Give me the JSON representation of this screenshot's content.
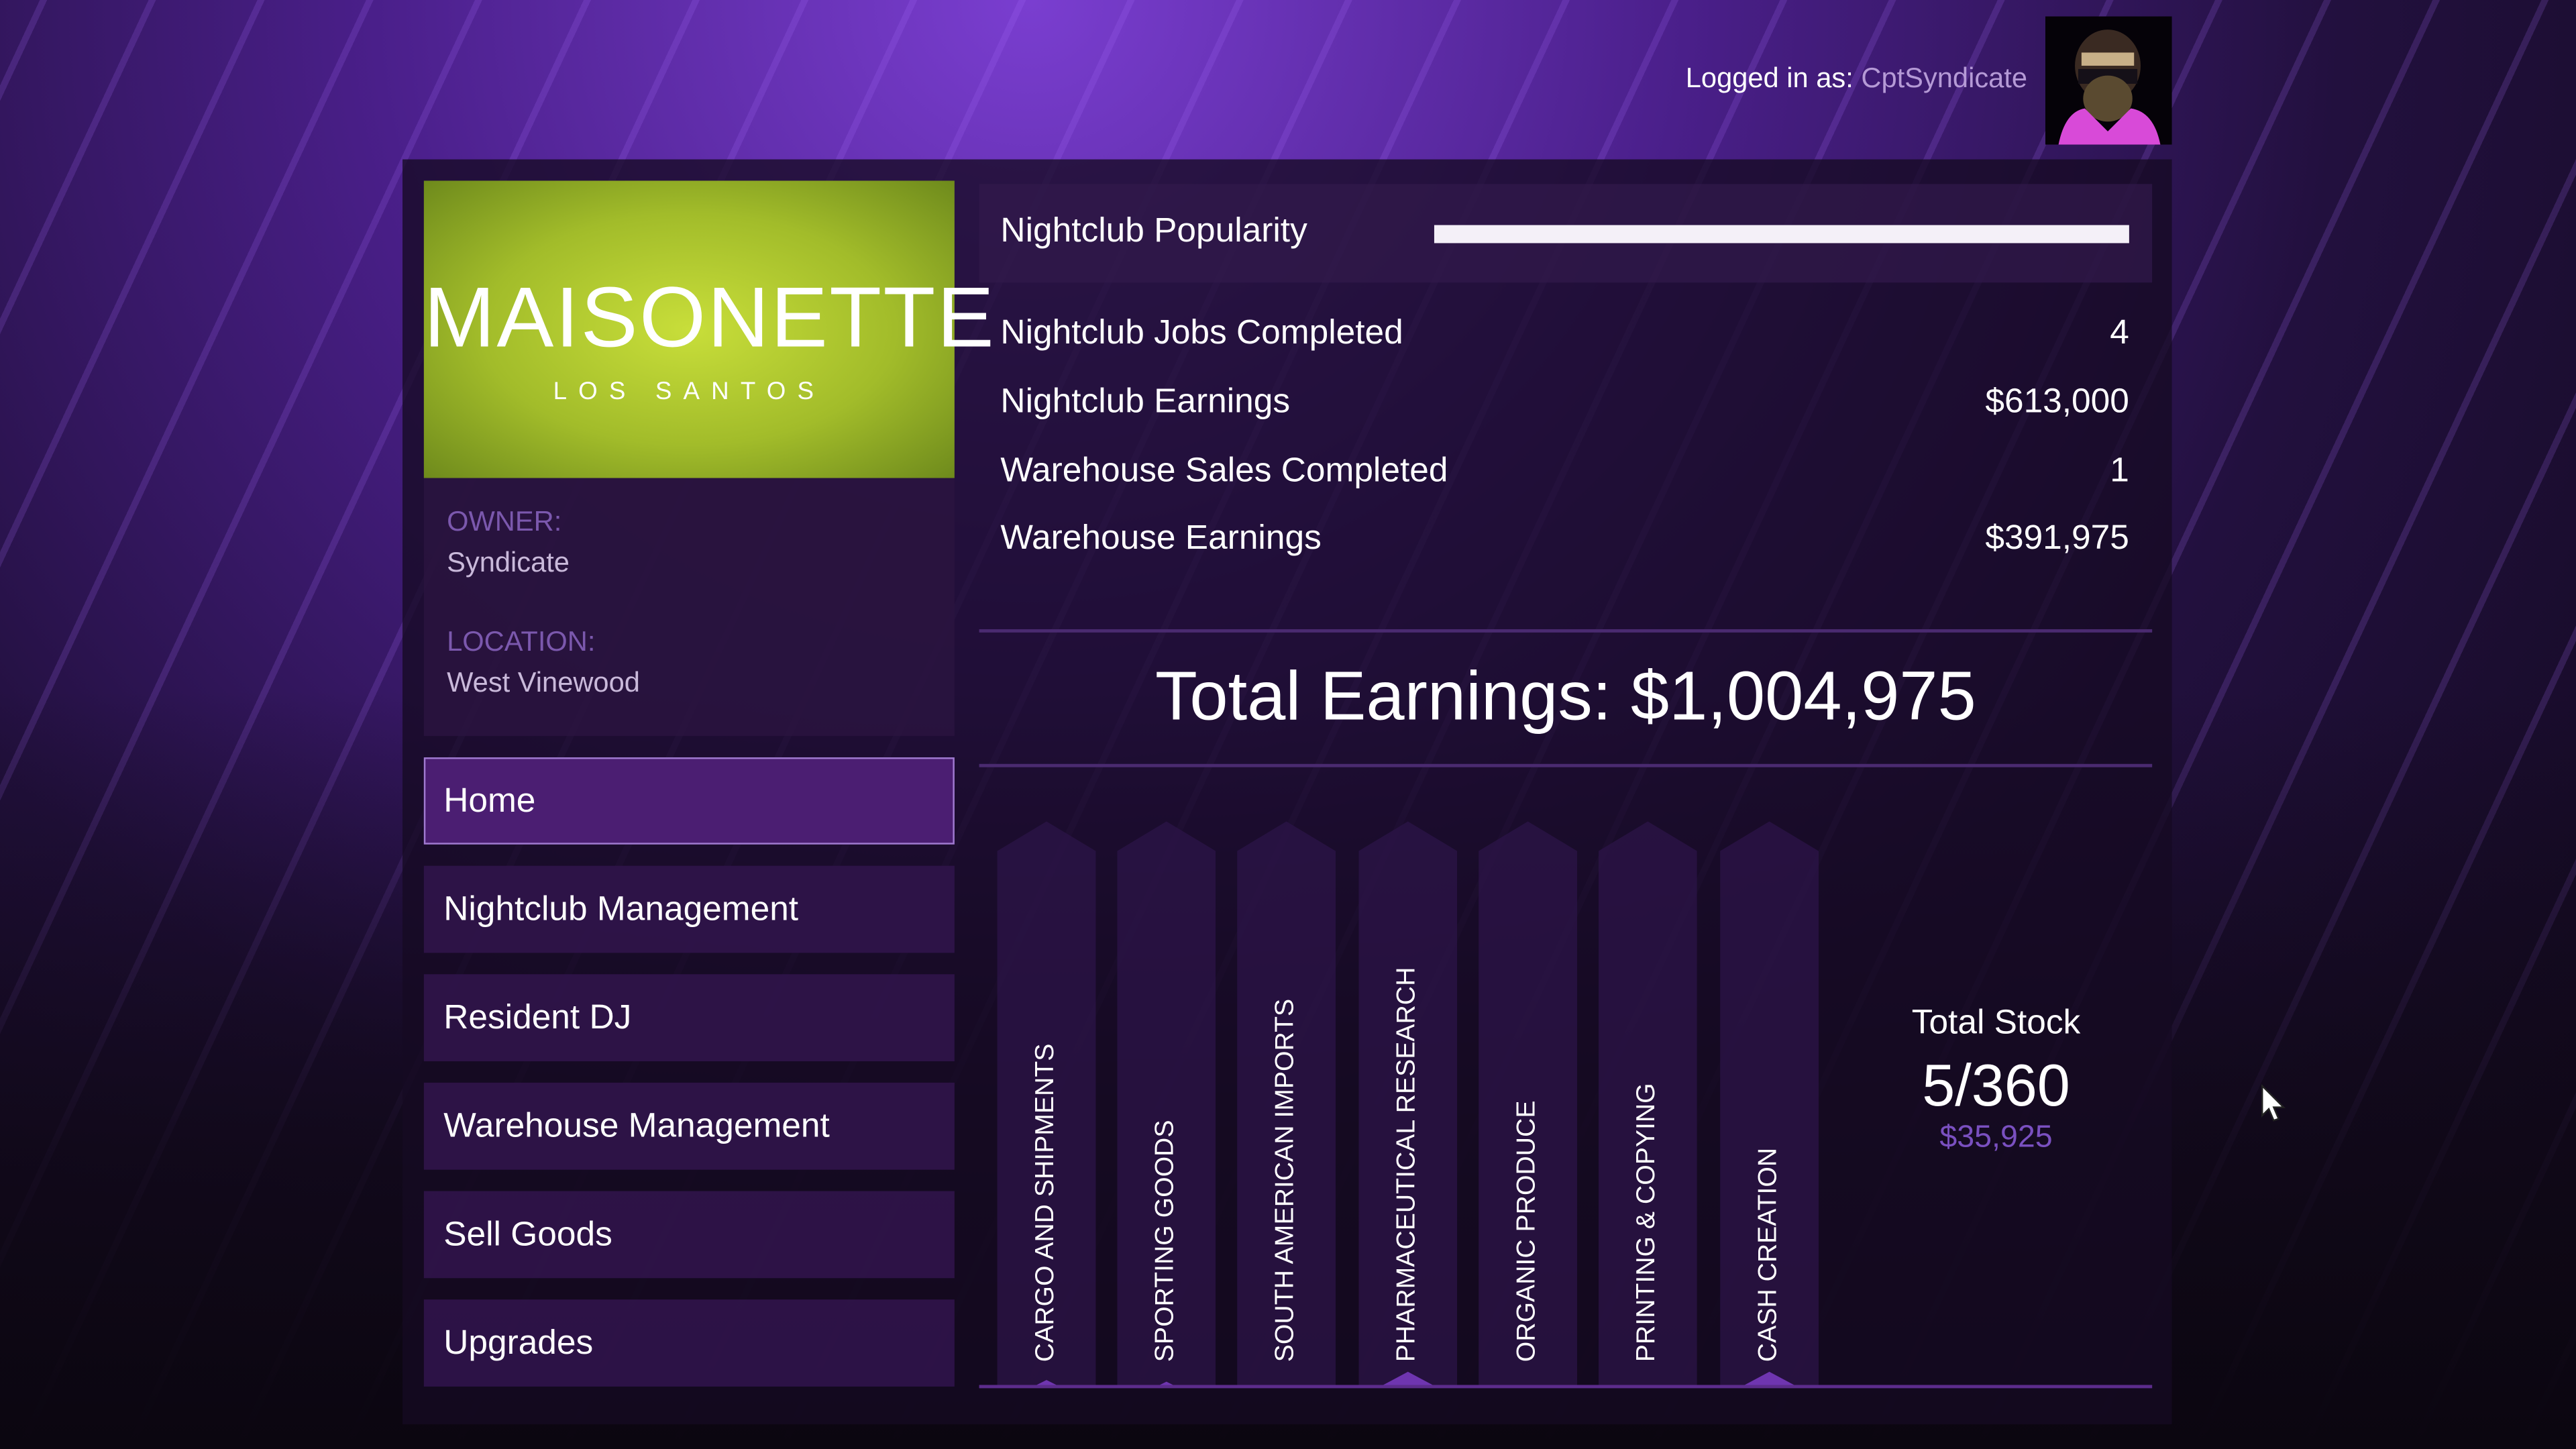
{
  "header": {
    "logged_in_label": "Logged in as:",
    "username": "CptSyndicate"
  },
  "business": {
    "logo_name": "MAISONETTE",
    "logo_sub": "LOS SANTOS",
    "owner_label": "OWNER:",
    "owner": "Syndicate",
    "location_label": "LOCATION:",
    "location": "West Vinewood"
  },
  "nav": [
    {
      "label": "Home",
      "selected": true
    },
    {
      "label": "Nightclub Management"
    },
    {
      "label": "Resident DJ"
    },
    {
      "label": "Warehouse Management"
    },
    {
      "label": "Sell Goods"
    },
    {
      "label": "Upgrades"
    }
  ],
  "popularity": {
    "label": "Nightclub Popularity",
    "value": 1.0
  },
  "stats": [
    {
      "label": "Nightclub Jobs Completed",
      "value": "4"
    },
    {
      "label": "Nightclub Earnings",
      "value": "$613,000"
    },
    {
      "label": "Warehouse Sales Completed",
      "value": "1"
    },
    {
      "label": "Warehouse Earnings",
      "value": "$391,975"
    }
  ],
  "total_earnings": "Total Earnings: $1,004,975",
  "goods": [
    {
      "name": "CARGO AND SHIPMENTS",
      "fill": 0.02
    },
    {
      "name": "SPORTING GOODS",
      "fill": 0.01
    },
    {
      "name": "SOUTH AMERICAN IMPORTS",
      "fill": 0
    },
    {
      "name": "PHARMACEUTICAL RESEARCH",
      "fill": 0.05
    },
    {
      "name": "ORGANIC PRODUCE",
      "fill": 0
    },
    {
      "name": "PRINTING & COPYING",
      "fill": 0
    },
    {
      "name": "CASH CREATION",
      "fill": 0.05
    }
  ],
  "stock": {
    "label": "Total Stock",
    "count": "5/360",
    "value": "$35,925"
  },
  "colors": {
    "accent": "#6f35b0",
    "value_purple": "#7a50c0"
  }
}
